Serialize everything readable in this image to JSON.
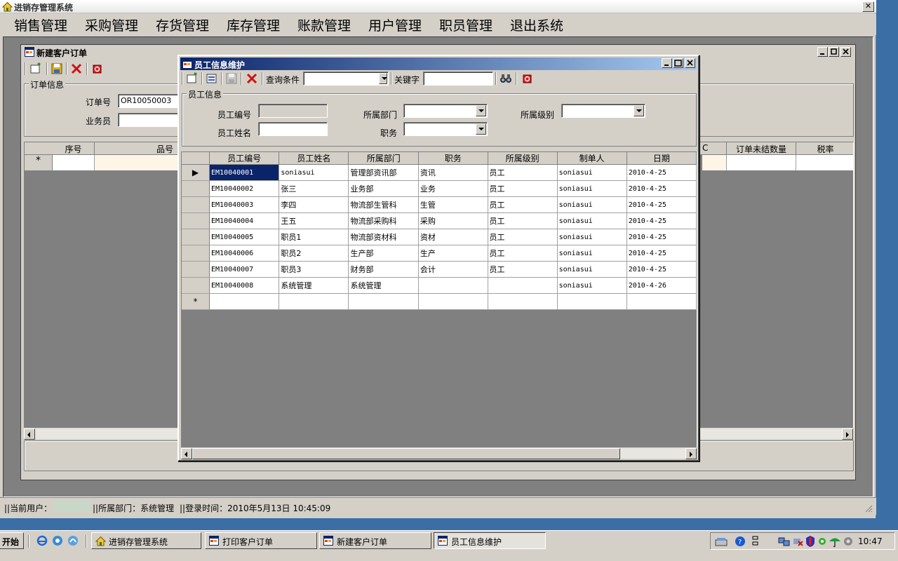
{
  "app": {
    "title": "进销存管理系统",
    "close": "✕"
  },
  "menu": [
    "销售管理",
    "采购管理",
    "存货管理",
    "库存管理",
    "账款管理",
    "用户管理",
    "职员管理",
    "退出系统"
  ],
  "order_window": {
    "title": "新建客户订单",
    "group_label": "订单信息",
    "order_no_label": "订单号",
    "order_no_value": "OR10050003",
    "salesman_label": "业务员",
    "grid_headers": [
      "序号",
      "品号",
      "订单未结数量",
      "税率"
    ],
    "header_fragment": "C",
    "new_row_marker": "*"
  },
  "employee_window": {
    "title": "员工信息维护",
    "query_condition_label": "查询条件",
    "keyword_label": "关键字",
    "group_label": "员工信息",
    "fields": {
      "emp_no": "员工编号",
      "emp_name": "员工姓名",
      "department": "所属部门",
      "position": "职务",
      "level": "所属级别"
    },
    "columns": [
      "员工编号",
      "员工姓名",
      "所属部门",
      "职务",
      "所属级别",
      "制单人",
      "日期"
    ],
    "rows": [
      [
        "EM10040001",
        "soniasui",
        "管理部资讯部",
        "资讯",
        "员工",
        "soniasui",
        "2010-4-25"
      ],
      [
        "EM10040002",
        "张三",
        "业务部",
        "业务",
        "员工",
        "soniasui",
        "2010-4-25"
      ],
      [
        "EM10040003",
        "李四",
        "物流部生管科",
        "生管",
        "员工",
        "soniasui",
        "2010-4-25"
      ],
      [
        "EM10040004",
        "王五",
        "物流部采购科",
        "采购",
        "员工",
        "soniasui",
        "2010-4-25"
      ],
      [
        "EM10040005",
        "职员1",
        "物流部资材科",
        "资材",
        "员工",
        "soniasui",
        "2010-4-25"
      ],
      [
        "EM10040006",
        "职员2",
        "生产部",
        "生产",
        "员工",
        "soniasui",
        "2010-4-25"
      ],
      [
        "EM10040007",
        "职员3",
        "财务部",
        "会计",
        "员工",
        "soniasui",
        "2010-4-25"
      ],
      [
        "EM10040008",
        "系统管理",
        "系统管理",
        "",
        "",
        "soniasui",
        "2010-4-26"
      ]
    ],
    "selected_row": 0,
    "new_row_marker": "*",
    "current_marker": "▶"
  },
  "statusbar": {
    "current_user_label": "||当前用户：",
    "department": "||所属部门：系统管理",
    "login_time": "||登录时间：2010年5月13日 10:45:09"
  },
  "taskbar": {
    "start": "开始",
    "tasks": [
      "进销存管理系统",
      "打印客户订单",
      "新建客户订单",
      "员工信息维护"
    ],
    "active_task": 3,
    "clock": "10:47"
  },
  "colors": {
    "desktop": "#3a6ea5",
    "face": "#d4d0c8",
    "caption_active": "#0a246a",
    "selection": "#0a246a"
  }
}
